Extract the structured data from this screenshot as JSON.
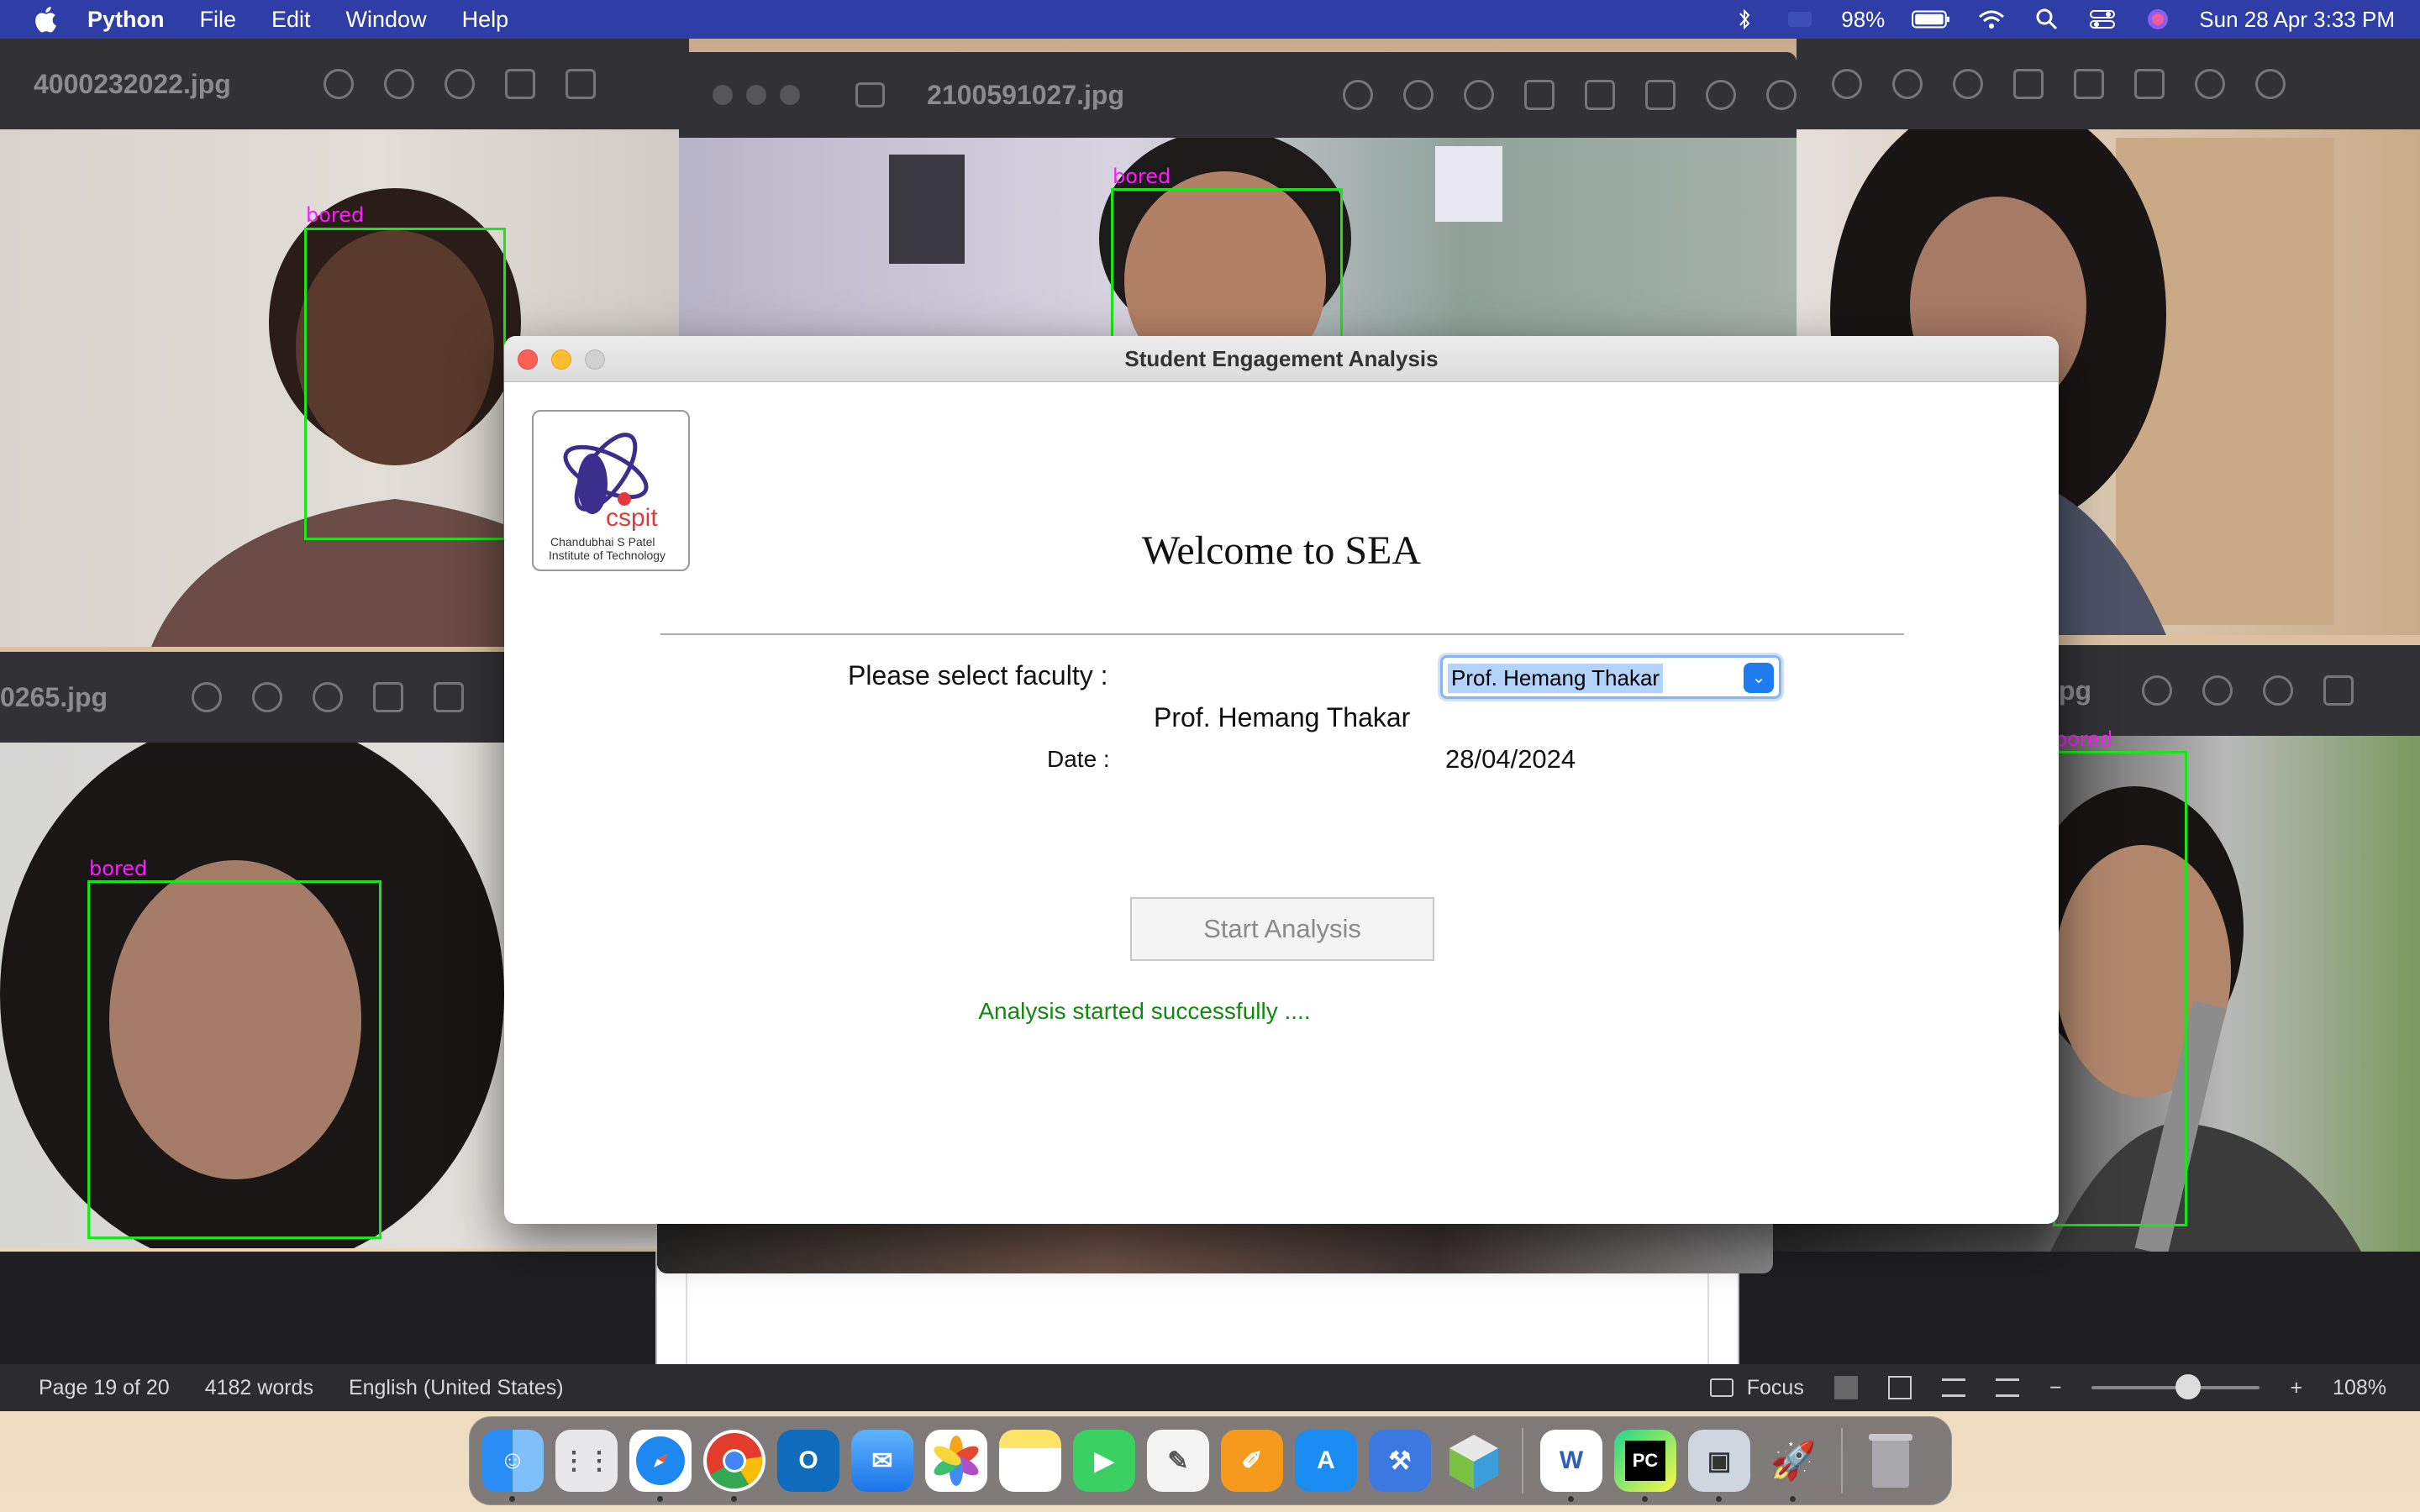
{
  "menubar": {
    "app_name": "Python",
    "menus": [
      "File",
      "Edit",
      "Window",
      "Help"
    ],
    "battery": "98%",
    "datetime": "Sun 28 Apr  3:33 PM"
  },
  "preview_windows": {
    "top_left_title": "4000232022.jpg",
    "top_middle_title": "2100591027.jpg",
    "bottom_left_title": "0265.jpg",
    "bottom_right_title": "pg",
    "face_label": "bored"
  },
  "word": {
    "page": "Page 19 of 20",
    "words": "4182 words",
    "language": "English (United States)",
    "focus": "Focus",
    "zoom": "108%"
  },
  "dialog": {
    "title": "Student Engagement Analysis",
    "logo_text": "cspit",
    "logo_sub1": "Chandubhai S Patel",
    "logo_sub2": "Institute of Technology",
    "welcome": "Welcome to SEA",
    "faculty_label": "Please select faculty :",
    "faculty_selected": "Prof. Hemang Thakar",
    "faculty_display": "Prof. Hemang Thakar",
    "date_label": "Date :",
    "date_value": "28/04/2024",
    "start_button": "Start Analysis",
    "status_message": "Analysis started successfully ...."
  },
  "dock": {
    "apps": [
      "finder",
      "launchpad",
      "safari",
      "chrome",
      "outlook",
      "mail",
      "photos",
      "notes",
      "facetime",
      "textedit",
      "pages",
      "app-store",
      "xcode",
      "blender-box",
      "word",
      "pycharm",
      "preview",
      "rocket",
      "trash"
    ]
  }
}
